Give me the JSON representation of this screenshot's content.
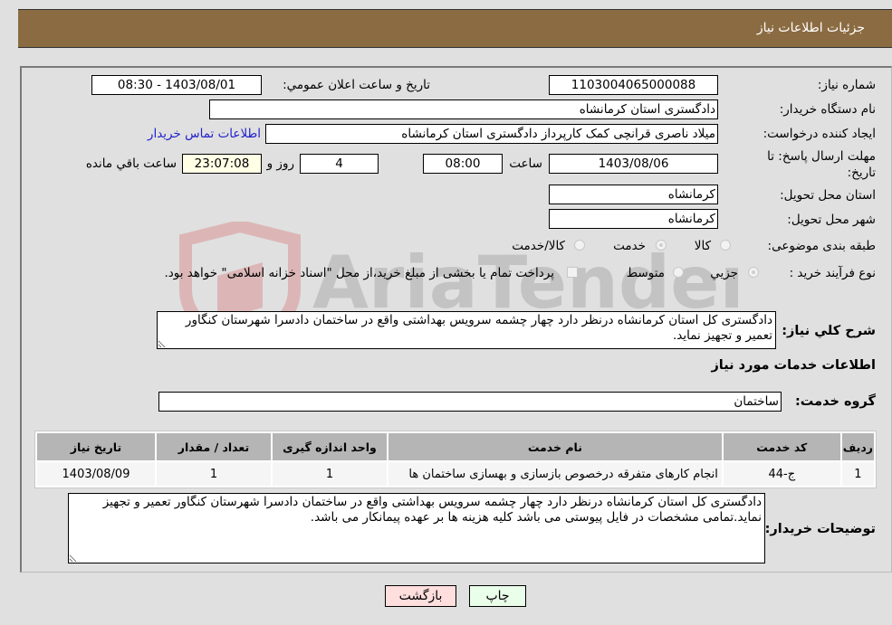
{
  "header": {
    "title": "جزئیات اطلاعات نیاز"
  },
  "form": {
    "need_number": {
      "label": "شماره نیاز:",
      "value": "1103004065000088"
    },
    "announce_datetime": {
      "label": "تاریخ و ساعت اعلان عمومي:",
      "value": "1403/08/01 - 08:30"
    },
    "buyer_org": {
      "label": "نام دستگاه خريدار:",
      "value": "دادگستری استان کرمانشاه"
    },
    "requester": {
      "label": "ايجاد کننده درخواست:",
      "value": "میلاد ناصری قرانچی کمک کارپرداز دادگستری استان کرمانشاه"
    },
    "buyer_contact_link": "اطلاعات تماس خريدار",
    "deadline": {
      "label_line1": "مهلت ارسال پاسخ: تا",
      "label_line2": "تاريخ:",
      "date": "1403/08/06",
      "time_label": "ساعت",
      "time": "08:00",
      "days": "4",
      "days_label": "روز و",
      "remaining": "23:07:08",
      "remaining_label": "ساعت باقي مانده"
    },
    "delivery_province": {
      "label": "استان محل تحویل:",
      "value": "کرمانشاه"
    },
    "delivery_city": {
      "label": "شهر محل تحویل:",
      "value": "کرمانشاه"
    },
    "category": {
      "label": "طبقه بندی موضوعی:",
      "options": [
        "کالا",
        "خدمت",
        "کالا/خدمت"
      ],
      "selected": "خدمت"
    },
    "purchase_type": {
      "label": "نوع فرآيند خريد :",
      "options": [
        "جزيي",
        "متوسط"
      ],
      "selected": "جزيي",
      "treasury_note": "پرداخت تمام يا بخشی از مبلغ خريد،از محل \"اسناد خزانه اسلامی\" خواهد بود."
    },
    "general_description": {
      "label": "شرح کلي نياز:",
      "value": "دادگستری کل استان کرمانشاه درنظر دارد چهار چشمه سرویس بهداشتی واقع در ساختمان دادسرا شهرستان کنگاور  تعمیر و تجهیز نماید."
    },
    "services_section_title": "اطلاعات خدمات مورد نياز",
    "service_group": {
      "label": "گروه خدمت:",
      "value": "ساختمان"
    },
    "services_table": {
      "columns": [
        "رديف",
        "کد خدمت",
        "نام خدمت",
        "واحد اندازه گیری",
        "تعداد / مقدار",
        "تاريخ نياز"
      ],
      "rows": [
        [
          "1",
          "ج-44",
          "انجام کارهای متفرقه درخصوص بازسازی و بهسازی ساختمان ها",
          "1",
          "1",
          "1403/08/09"
        ]
      ]
    },
    "buyer_notes": {
      "label": "توضيحات خريدار:",
      "value": "دادگستری کل استان کرمانشاه درنظر دارد چهار چشمه سرویس بهداشتی واقع در ساختمان دادسرا شهرستان کنگاور تعمیر و تجهیز نماید.تمامی مشخصات در فایل پیوستی می باشد کلیه هزینه ها بر عهده پیمانکار می باشد."
    }
  },
  "buttons": {
    "print": "چاپ",
    "back": "بازگشت"
  },
  "watermark": {
    "text": "AriaTender.neT"
  },
  "colors": {
    "header_bg": "#8b6c42",
    "print_bg": "#eaffea",
    "back_bg": "#ffdede",
    "link": "#2222cc"
  }
}
